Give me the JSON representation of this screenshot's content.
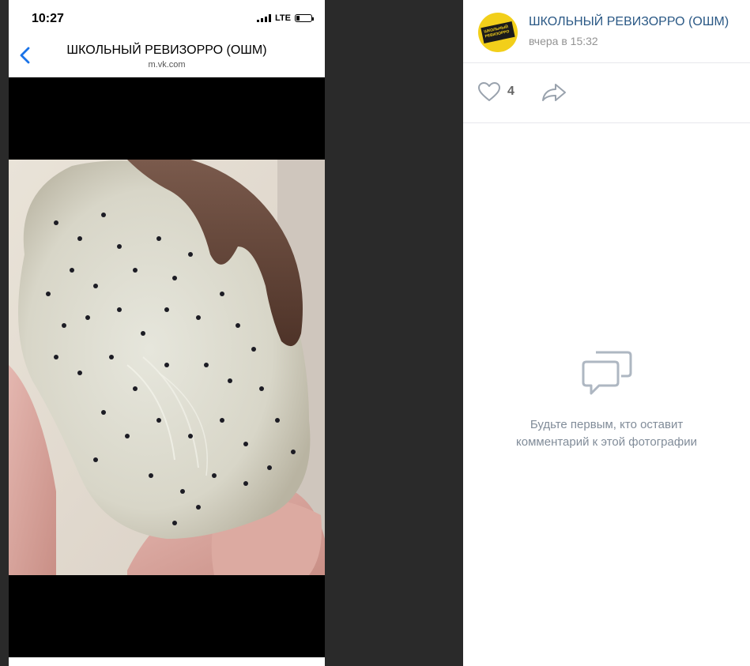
{
  "phone": {
    "status": {
      "time": "10:27",
      "network": "LTE"
    },
    "nav": {
      "title": "ШКОЛЬНЫЙ РЕВИЗОРРО (ОШМ)",
      "domain": "m.vk.com"
    }
  },
  "post": {
    "group_name": "ШКОЛЬНЫЙ РЕВИЗОРРО (ОШМ)",
    "time": "вчера в 15:32",
    "avatar_text": "ШКОЛЬНЫЙ РЕВИЗОРРО",
    "likes": "4"
  },
  "comments": {
    "empty_line1": "Будьте первым, кто оставит",
    "empty_line2": "комментарий к этой фотографии"
  },
  "colors": {
    "link": "#2a5885",
    "muted": "#939393",
    "accent_yellow": "#f2cf1a",
    "ios_blue": "#1a73e8"
  },
  "icons": [
    "back-chevron-icon",
    "signal-icon",
    "battery-icon",
    "heart-icon",
    "share-icon",
    "comments-icon"
  ]
}
